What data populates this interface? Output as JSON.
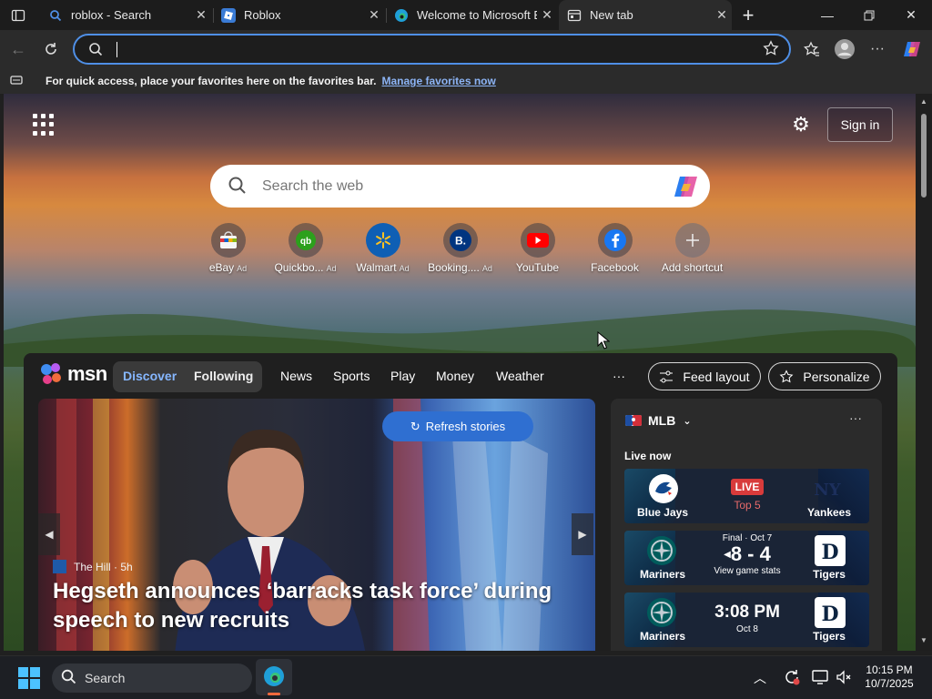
{
  "tabs": [
    {
      "title": "roblox - Search",
      "icon": "search-favicon-icon"
    },
    {
      "title": "Roblox",
      "icon": "roblox-favicon-icon"
    },
    {
      "title": "Welcome to Microsoft Ed",
      "icon": "edge-favicon-icon"
    },
    {
      "title": "New tab",
      "icon": "newtab-favicon-icon",
      "active": true
    }
  ],
  "favorites_bar": {
    "text": "For quick access, place your favorites here on the favorites bar.",
    "link": "Manage favorites now"
  },
  "address_bar": {
    "value": ""
  },
  "newtab": {
    "signin_label": "Sign in",
    "search_placeholder": "Search the web",
    "shortcuts": [
      {
        "label": "eBay",
        "ad": "Ad",
        "color": "#ffffff",
        "icon": "ebay-icon"
      },
      {
        "label": "Quickbo...",
        "ad": "Ad",
        "color": "#2ca01c",
        "icon": "quickbooks-icon"
      },
      {
        "label": "Walmart",
        "ad": "Ad",
        "color": "#0071ce",
        "icon": "walmart-icon"
      },
      {
        "label": "Booking....",
        "ad": "Ad",
        "color": "#003580",
        "icon": "booking-icon"
      },
      {
        "label": "YouTube",
        "ad": "",
        "color": "#ff0000",
        "icon": "youtube-icon"
      },
      {
        "label": "Facebook",
        "ad": "",
        "color": "#1877f2",
        "icon": "facebook-icon"
      },
      {
        "label": "Add shortcut",
        "ad": "",
        "color": "#8a8a8a",
        "icon": "plus-icon"
      }
    ]
  },
  "feed": {
    "brand": "msn",
    "nav": {
      "discover": "Discover",
      "following": "Following",
      "items": [
        "News",
        "Sports",
        "Play",
        "Money",
        "Weather"
      ],
      "more": "···"
    },
    "feed_layout": "Feed layout",
    "personalize": "Personalize",
    "refresh": "Refresh stories",
    "hero": {
      "source": "The Hill",
      "age": "5h",
      "source_meta": "The Hill · 5h",
      "headline": "Hegseth announces ‘barracks task force’ during speech to new recruits"
    },
    "mlb": {
      "title": "MLB",
      "live_now": "Live now",
      "games": [
        {
          "away": "Blue Jays",
          "home": "Yankees",
          "status": "LIVE",
          "detail": "Top 5",
          "score": ""
        },
        {
          "away": "Mariners",
          "home": "Tigers",
          "status": "Final · Oct 7",
          "score": "8 - 4",
          "detail": "View game stats"
        },
        {
          "away": "Mariners",
          "home": "Tigers",
          "status": "3:08 PM",
          "detail": "Oct 8",
          "score": ""
        }
      ]
    }
  },
  "taskbar": {
    "search_label": "Search",
    "time": "10:15 PM",
    "date": "10/7/2025"
  },
  "colors": {
    "accent": "#4f8fe6",
    "refresh_button": "#2f6fd1",
    "live_badge": "#d83b3b"
  }
}
